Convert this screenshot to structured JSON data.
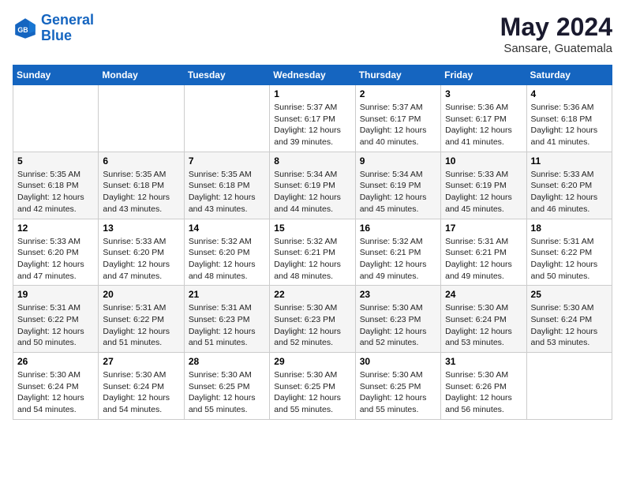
{
  "header": {
    "logo_line1": "General",
    "logo_line2": "Blue",
    "month_year": "May 2024",
    "location": "Sansare, Guatemala"
  },
  "days_of_week": [
    "Sunday",
    "Monday",
    "Tuesday",
    "Wednesday",
    "Thursday",
    "Friday",
    "Saturday"
  ],
  "weeks": [
    [
      {
        "day": "",
        "sunrise": "",
        "sunset": "",
        "daylight": ""
      },
      {
        "day": "",
        "sunrise": "",
        "sunset": "",
        "daylight": ""
      },
      {
        "day": "",
        "sunrise": "",
        "sunset": "",
        "daylight": ""
      },
      {
        "day": "1",
        "sunrise": "Sunrise: 5:37 AM",
        "sunset": "Sunset: 6:17 PM",
        "daylight": "Daylight: 12 hours and 39 minutes."
      },
      {
        "day": "2",
        "sunrise": "Sunrise: 5:37 AM",
        "sunset": "Sunset: 6:17 PM",
        "daylight": "Daylight: 12 hours and 40 minutes."
      },
      {
        "day": "3",
        "sunrise": "Sunrise: 5:36 AM",
        "sunset": "Sunset: 6:17 PM",
        "daylight": "Daylight: 12 hours and 41 minutes."
      },
      {
        "day": "4",
        "sunrise": "Sunrise: 5:36 AM",
        "sunset": "Sunset: 6:18 PM",
        "daylight": "Daylight: 12 hours and 41 minutes."
      }
    ],
    [
      {
        "day": "5",
        "sunrise": "Sunrise: 5:35 AM",
        "sunset": "Sunset: 6:18 PM",
        "daylight": "Daylight: 12 hours and 42 minutes."
      },
      {
        "day": "6",
        "sunrise": "Sunrise: 5:35 AM",
        "sunset": "Sunset: 6:18 PM",
        "daylight": "Daylight: 12 hours and 43 minutes."
      },
      {
        "day": "7",
        "sunrise": "Sunrise: 5:35 AM",
        "sunset": "Sunset: 6:18 PM",
        "daylight": "Daylight: 12 hours and 43 minutes."
      },
      {
        "day": "8",
        "sunrise": "Sunrise: 5:34 AM",
        "sunset": "Sunset: 6:19 PM",
        "daylight": "Daylight: 12 hours and 44 minutes."
      },
      {
        "day": "9",
        "sunrise": "Sunrise: 5:34 AM",
        "sunset": "Sunset: 6:19 PM",
        "daylight": "Daylight: 12 hours and 45 minutes."
      },
      {
        "day": "10",
        "sunrise": "Sunrise: 5:33 AM",
        "sunset": "Sunset: 6:19 PM",
        "daylight": "Daylight: 12 hours and 45 minutes."
      },
      {
        "day": "11",
        "sunrise": "Sunrise: 5:33 AM",
        "sunset": "Sunset: 6:20 PM",
        "daylight": "Daylight: 12 hours and 46 minutes."
      }
    ],
    [
      {
        "day": "12",
        "sunrise": "Sunrise: 5:33 AM",
        "sunset": "Sunset: 6:20 PM",
        "daylight": "Daylight: 12 hours and 47 minutes."
      },
      {
        "day": "13",
        "sunrise": "Sunrise: 5:33 AM",
        "sunset": "Sunset: 6:20 PM",
        "daylight": "Daylight: 12 hours and 47 minutes."
      },
      {
        "day": "14",
        "sunrise": "Sunrise: 5:32 AM",
        "sunset": "Sunset: 6:20 PM",
        "daylight": "Daylight: 12 hours and 48 minutes."
      },
      {
        "day": "15",
        "sunrise": "Sunrise: 5:32 AM",
        "sunset": "Sunset: 6:21 PM",
        "daylight": "Daylight: 12 hours and 48 minutes."
      },
      {
        "day": "16",
        "sunrise": "Sunrise: 5:32 AM",
        "sunset": "Sunset: 6:21 PM",
        "daylight": "Daylight: 12 hours and 49 minutes."
      },
      {
        "day": "17",
        "sunrise": "Sunrise: 5:31 AM",
        "sunset": "Sunset: 6:21 PM",
        "daylight": "Daylight: 12 hours and 49 minutes."
      },
      {
        "day": "18",
        "sunrise": "Sunrise: 5:31 AM",
        "sunset": "Sunset: 6:22 PM",
        "daylight": "Daylight: 12 hours and 50 minutes."
      }
    ],
    [
      {
        "day": "19",
        "sunrise": "Sunrise: 5:31 AM",
        "sunset": "Sunset: 6:22 PM",
        "daylight": "Daylight: 12 hours and 50 minutes."
      },
      {
        "day": "20",
        "sunrise": "Sunrise: 5:31 AM",
        "sunset": "Sunset: 6:22 PM",
        "daylight": "Daylight: 12 hours and 51 minutes."
      },
      {
        "day": "21",
        "sunrise": "Sunrise: 5:31 AM",
        "sunset": "Sunset: 6:23 PM",
        "daylight": "Daylight: 12 hours and 51 minutes."
      },
      {
        "day": "22",
        "sunrise": "Sunrise: 5:30 AM",
        "sunset": "Sunset: 6:23 PM",
        "daylight": "Daylight: 12 hours and 52 minutes."
      },
      {
        "day": "23",
        "sunrise": "Sunrise: 5:30 AM",
        "sunset": "Sunset: 6:23 PM",
        "daylight": "Daylight: 12 hours and 52 minutes."
      },
      {
        "day": "24",
        "sunrise": "Sunrise: 5:30 AM",
        "sunset": "Sunset: 6:24 PM",
        "daylight": "Daylight: 12 hours and 53 minutes."
      },
      {
        "day": "25",
        "sunrise": "Sunrise: 5:30 AM",
        "sunset": "Sunset: 6:24 PM",
        "daylight": "Daylight: 12 hours and 53 minutes."
      }
    ],
    [
      {
        "day": "26",
        "sunrise": "Sunrise: 5:30 AM",
        "sunset": "Sunset: 6:24 PM",
        "daylight": "Daylight: 12 hours and 54 minutes."
      },
      {
        "day": "27",
        "sunrise": "Sunrise: 5:30 AM",
        "sunset": "Sunset: 6:24 PM",
        "daylight": "Daylight: 12 hours and 54 minutes."
      },
      {
        "day": "28",
        "sunrise": "Sunrise: 5:30 AM",
        "sunset": "Sunset: 6:25 PM",
        "daylight": "Daylight: 12 hours and 55 minutes."
      },
      {
        "day": "29",
        "sunrise": "Sunrise: 5:30 AM",
        "sunset": "Sunset: 6:25 PM",
        "daylight": "Daylight: 12 hours and 55 minutes."
      },
      {
        "day": "30",
        "sunrise": "Sunrise: 5:30 AM",
        "sunset": "Sunset: 6:25 PM",
        "daylight": "Daylight: 12 hours and 55 minutes."
      },
      {
        "day": "31",
        "sunrise": "Sunrise: 5:30 AM",
        "sunset": "Sunset: 6:26 PM",
        "daylight": "Daylight: 12 hours and 56 minutes."
      },
      {
        "day": "",
        "sunrise": "",
        "sunset": "",
        "daylight": ""
      }
    ]
  ]
}
